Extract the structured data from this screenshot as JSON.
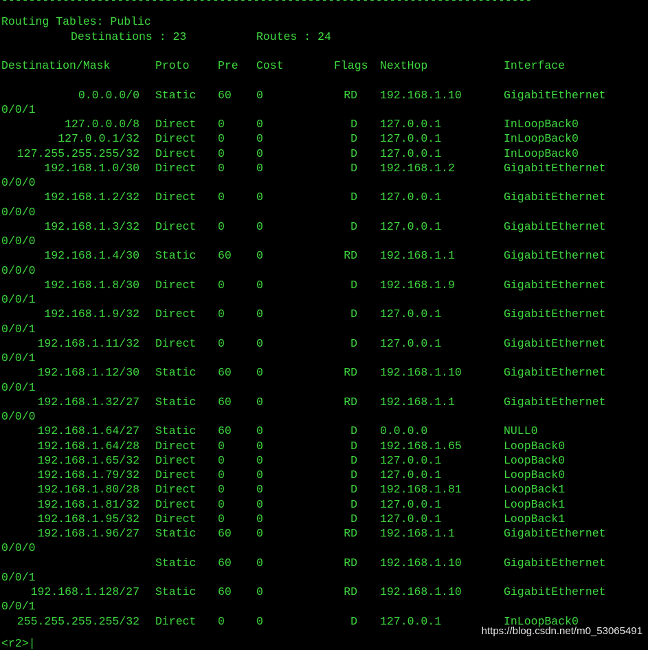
{
  "separator": "------------------------------------------------------------------------------",
  "title": "Routing Tables: Public",
  "summary": {
    "destinations_label": "Destinations : 23",
    "routes_label": "Routes : 24"
  },
  "headers": {
    "destination": "Destination/Mask",
    "proto": "Proto",
    "pre": "Pre",
    "cost": "Cost",
    "flags": "Flags",
    "nexthop": "NextHop",
    "interface": "Interface"
  },
  "rows": [
    {
      "dest": "0.0.0.0/0",
      "proto": "Static",
      "pre": "60",
      "cost": "0",
      "flags": "RD",
      "nexthop": "192.168.1.10",
      "iface": "GigabitEthernet",
      "cont": "0/0/1"
    },
    {
      "dest": "127.0.0.0/8",
      "proto": "Direct",
      "pre": "0",
      "cost": "0",
      "flags": "D",
      "nexthop": "127.0.0.1",
      "iface": "InLoopBack0",
      "cont": ""
    },
    {
      "dest": "127.0.0.1/32",
      "proto": "Direct",
      "pre": "0",
      "cost": "0",
      "flags": "D",
      "nexthop": "127.0.0.1",
      "iface": "InLoopBack0",
      "cont": ""
    },
    {
      "dest": "127.255.255.255/32",
      "proto": "Direct",
      "pre": "0",
      "cost": "0",
      "flags": "D",
      "nexthop": "127.0.0.1",
      "iface": "InLoopBack0",
      "cont": ""
    },
    {
      "dest": "192.168.1.0/30",
      "proto": "Direct",
      "pre": "0",
      "cost": "0",
      "flags": "D",
      "nexthop": "192.168.1.2",
      "iface": "GigabitEthernet",
      "cont": "0/0/0"
    },
    {
      "dest": "192.168.1.2/32",
      "proto": "Direct",
      "pre": "0",
      "cost": "0",
      "flags": "D",
      "nexthop": "127.0.0.1",
      "iface": "GigabitEthernet",
      "cont": "0/0/0"
    },
    {
      "dest": "192.168.1.3/32",
      "proto": "Direct",
      "pre": "0",
      "cost": "0",
      "flags": "D",
      "nexthop": "127.0.0.1",
      "iface": "GigabitEthernet",
      "cont": "0/0/0"
    },
    {
      "dest": "192.168.1.4/30",
      "proto": "Static",
      "pre": "60",
      "cost": "0",
      "flags": "RD",
      "nexthop": "192.168.1.1",
      "iface": "GigabitEthernet",
      "cont": "0/0/0"
    },
    {
      "dest": "192.168.1.8/30",
      "proto": "Direct",
      "pre": "0",
      "cost": "0",
      "flags": "D",
      "nexthop": "192.168.1.9",
      "iface": "GigabitEthernet",
      "cont": "0/0/1"
    },
    {
      "dest": "192.168.1.9/32",
      "proto": "Direct",
      "pre": "0",
      "cost": "0",
      "flags": "D",
      "nexthop": "127.0.0.1",
      "iface": "GigabitEthernet",
      "cont": "0/0/1"
    },
    {
      "dest": "192.168.1.11/32",
      "proto": "Direct",
      "pre": "0",
      "cost": "0",
      "flags": "D",
      "nexthop": "127.0.0.1",
      "iface": "GigabitEthernet",
      "cont": "0/0/1"
    },
    {
      "dest": "192.168.1.12/30",
      "proto": "Static",
      "pre": "60",
      "cost": "0",
      "flags": "RD",
      "nexthop": "192.168.1.10",
      "iface": "GigabitEthernet",
      "cont": "0/0/1"
    },
    {
      "dest": "192.168.1.32/27",
      "proto": "Static",
      "pre": "60",
      "cost": "0",
      "flags": "RD",
      "nexthop": "192.168.1.1",
      "iface": "GigabitEthernet",
      "cont": "0/0/0"
    },
    {
      "dest": "192.168.1.64/27",
      "proto": "Static",
      "pre": "60",
      "cost": "0",
      "flags": "D",
      "nexthop": "0.0.0.0",
      "iface": "NULL0",
      "cont": ""
    },
    {
      "dest": "192.168.1.64/28",
      "proto": "Direct",
      "pre": "0",
      "cost": "0",
      "flags": "D",
      "nexthop": "192.168.1.65",
      "iface": "LoopBack0",
      "cont": ""
    },
    {
      "dest": "192.168.1.65/32",
      "proto": "Direct",
      "pre": "0",
      "cost": "0",
      "flags": "D",
      "nexthop": "127.0.0.1",
      "iface": "LoopBack0",
      "cont": ""
    },
    {
      "dest": "192.168.1.79/32",
      "proto": "Direct",
      "pre": "0",
      "cost": "0",
      "flags": "D",
      "nexthop": "127.0.0.1",
      "iface": "LoopBack0",
      "cont": ""
    },
    {
      "dest": "192.168.1.80/28",
      "proto": "Direct",
      "pre": "0",
      "cost": "0",
      "flags": "D",
      "nexthop": "192.168.1.81",
      "iface": "LoopBack1",
      "cont": ""
    },
    {
      "dest": "192.168.1.81/32",
      "proto": "Direct",
      "pre": "0",
      "cost": "0",
      "flags": "D",
      "nexthop": "127.0.0.1",
      "iface": "LoopBack1",
      "cont": ""
    },
    {
      "dest": "192.168.1.95/32",
      "proto": "Direct",
      "pre": "0",
      "cost": "0",
      "flags": "D",
      "nexthop": "127.0.0.1",
      "iface": "LoopBack1",
      "cont": ""
    },
    {
      "dest": "192.168.1.96/27",
      "proto": "Static",
      "pre": "60",
      "cost": "0",
      "flags": "RD",
      "nexthop": "192.168.1.1",
      "iface": "GigabitEthernet",
      "cont": "0/0/0"
    },
    {
      "dest": "",
      "proto": "Static",
      "pre": "60",
      "cost": "0",
      "flags": "RD",
      "nexthop": "192.168.1.10",
      "iface": "GigabitEthernet",
      "cont": "0/0/1"
    },
    {
      "dest": "192.168.1.128/27",
      "proto": "Static",
      "pre": "60",
      "cost": "0",
      "flags": "RD",
      "nexthop": "192.168.1.10",
      "iface": "GigabitEthernet",
      "cont": "0/0/1"
    },
    {
      "dest": "255.255.255.255/32",
      "proto": "Direct",
      "pre": "0",
      "cost": "0",
      "flags": "D",
      "nexthop": "127.0.0.1",
      "iface": "InLoopBack0",
      "cont": ""
    }
  ],
  "prompt": "<r2>",
  "watermark": "https://blog.csdn.net/m0_53065491",
  "colors": {
    "background": "#000000",
    "text": "#3fd83f"
  }
}
